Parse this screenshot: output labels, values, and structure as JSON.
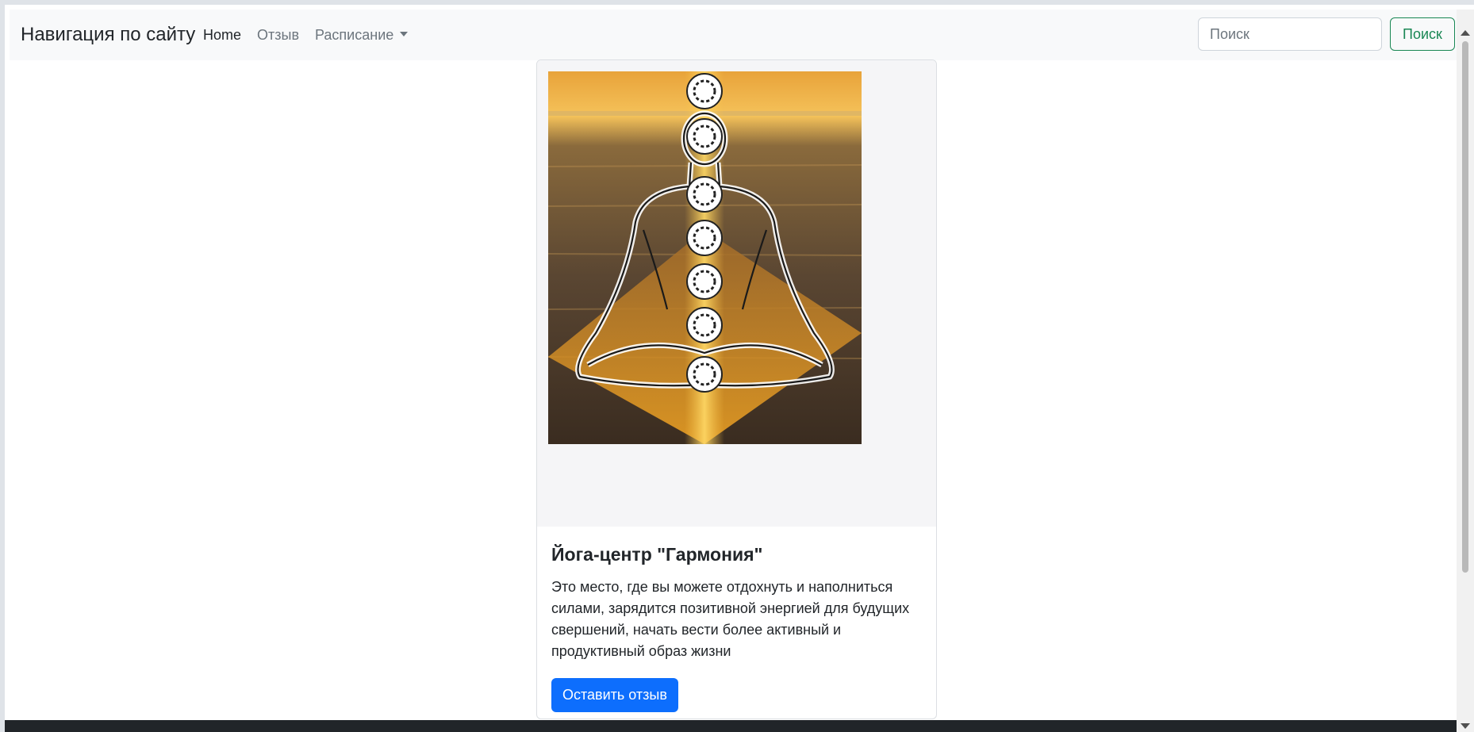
{
  "navbar": {
    "brand": "Навигация по сайту",
    "links": [
      {
        "label": "Home",
        "active": true
      },
      {
        "label": "Отзыв",
        "active": false
      },
      {
        "label": "Расписание",
        "dropdown": true
      }
    ],
    "search": {
      "placeholder": "Поиск",
      "value": ""
    },
    "search_button": "Поиск"
  },
  "card": {
    "image_icon": "yoga-meditation-chakra-illustration",
    "title": "Йога-центр \"Гармония\"",
    "text": "Это место, где вы можете отдохнуть и наполниться силами, зарядится позитивной энергией для будущих свершений, начать вести более активный и продуктивный образ жизни",
    "button": "Оставить отзыв"
  },
  "colors": {
    "primary": "#0d6efd",
    "success": "#198754",
    "navbar_bg": "#f8f9fa",
    "footer": "#212529"
  }
}
